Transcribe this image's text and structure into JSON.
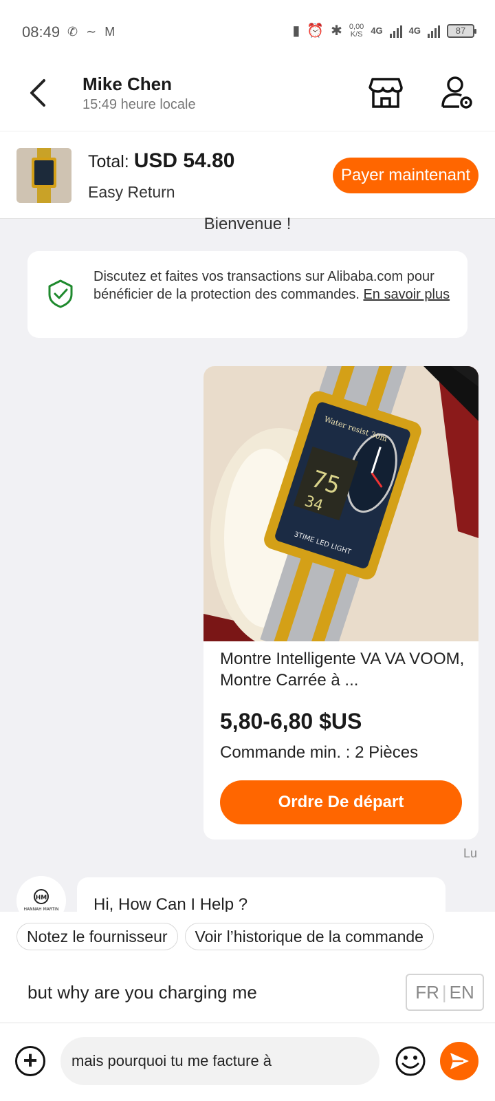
{
  "status_bar": {
    "time": "08:49",
    "net_speed_value": "0,00",
    "net_speed_unit": "K/S",
    "network1": "4G",
    "network2": "4G",
    "battery": "87"
  },
  "header": {
    "contact_name": "Mike Chen",
    "local_time": "15:49 heure locale"
  },
  "order": {
    "total_label": "Total:",
    "total_value": "USD 54.80",
    "easy_return": "Easy Return",
    "pay_button": "Payer maintenant"
  },
  "chat": {
    "welcome": "Bienvenue !",
    "notice_text": "Discutez et faites vos transactions sur Alibaba.com pour bénéficier de la protection des commandes. ",
    "notice_link": "En savoir plus",
    "product": {
      "title": "Montre Intelligente VA VA VOOM, Montre Carrée à ...",
      "price": "5,80-6,80 $US",
      "moq": "Commande min. :  2 Pièces",
      "order_button": "Ordre De départ",
      "watch_text": "Water resist 30m",
      "watch_bottom": "3TIME  LED LIGHT"
    },
    "read_status": "Lu",
    "avatar_text": "HANNAH MARTIN",
    "avatar_logo": "HM",
    "incoming_message": "Hi, How Can I Help ?"
  },
  "quick_actions": [
    "Notez le fournisseur",
    "Voir l’historique de la commande"
  ],
  "composer": {
    "translation_preview": "but why are you charging me",
    "lang_from": "FR",
    "lang_to": "EN",
    "input_value": "mais pourquoi tu me facture à"
  },
  "colors": {
    "accent": "#ff6600",
    "shield": "#1f8a2e"
  }
}
